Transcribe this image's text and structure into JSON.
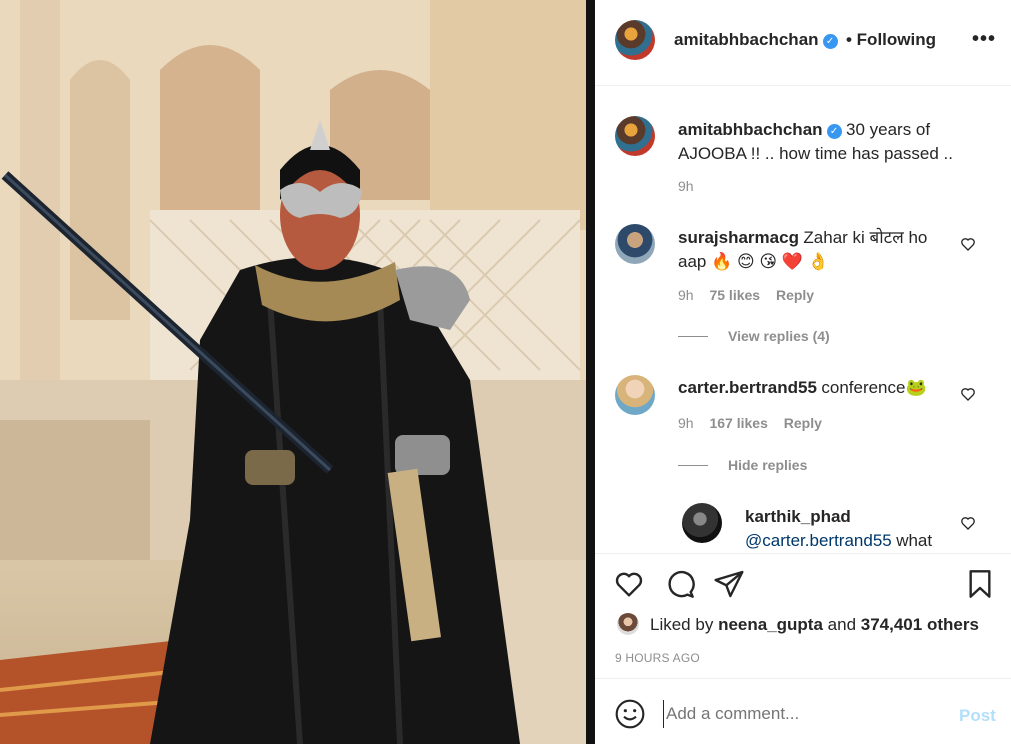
{
  "post": {
    "author": "amitabhbachchan",
    "follow_state": "• Following",
    "more_icon": "more-horizontal-icon",
    "photo_alt": "Man in black costume with silver mask holding a sword"
  },
  "caption": {
    "username": "amitabhbachchan",
    "text_line1": "30 years of",
    "text_line2": "AJOOBA !! .. how time has passed ..",
    "time": "9h"
  },
  "comments": [
    {
      "username": "surajsharmacg",
      "text_line1": "Zahar ki बोटल ho",
      "text_line2": "aap 🔥 😊 😘 ❤️ 👌",
      "time": "9h",
      "likes": "75 likes",
      "reply": "Reply",
      "replies_toggle": "View replies (4)"
    },
    {
      "username": "carter.bertrand55",
      "text": "conference🐸",
      "time": "9h",
      "likes": "167 likes",
      "reply": "Reply",
      "replies_toggle": "Hide replies"
    },
    {
      "username": "karthik_phad",
      "mention": "@carter.bertrand55",
      "text": "what"
    }
  ],
  "likes": {
    "prefix": "Liked by",
    "user": "neena_gupta",
    "and": "and",
    "count": "374,401 others"
  },
  "timestamp": "9 HOURS AGO",
  "composer": {
    "placeholder": "Add a comment...",
    "post_label": "Post"
  },
  "colors": {
    "verified": "#3897f0",
    "link": "#00376b",
    "post_disabled": "#b2dffc",
    "meta": "#8e8e8e"
  }
}
